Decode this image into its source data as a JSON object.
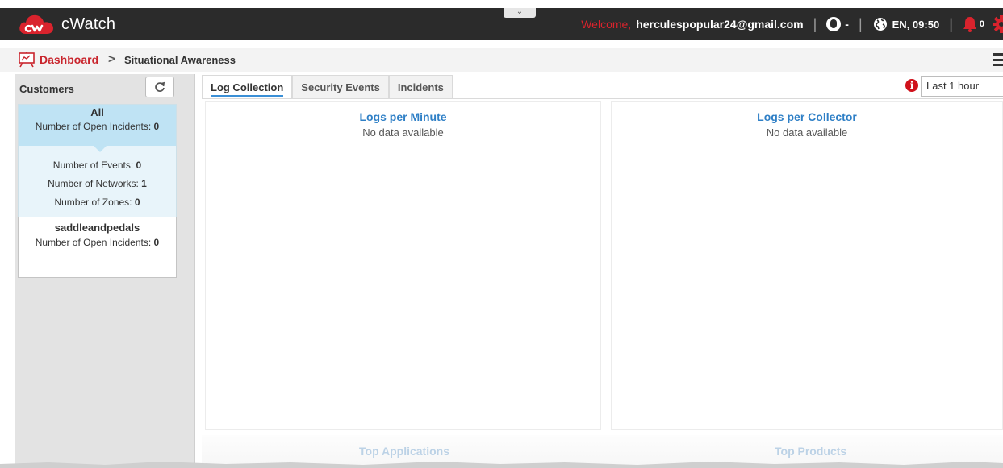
{
  "app": {
    "name": "cWatch",
    "collapse_glyph": "⌄"
  },
  "header": {
    "welcome": "Welcome,",
    "email": "herculespopular24@gmail.com",
    "user_caret": "-",
    "lang_time": "EN, 09:50",
    "notifications": "0",
    "separator": "|",
    "brand_color": "#d9232d"
  },
  "breadcrumb": {
    "root": "Dashboard",
    "chevron": ">",
    "current": "Situational Awareness"
  },
  "sidebar": {
    "title": "Customers",
    "all": {
      "name": "All",
      "open_incidents_label": "Number of Open Incidents:",
      "open_incidents": "0",
      "events_label": "Number of Events:",
      "events": "0",
      "networks_label": "Number of Networks:",
      "networks": "1",
      "zones_label": "Number of Zones:",
      "zones": "0"
    },
    "customers": [
      {
        "name": "saddleandpedals",
        "open_incidents_label": "Number of Open Incidents:",
        "open_incidents": "0"
      }
    ]
  },
  "tabs": [
    {
      "label": "Log Collection",
      "active": true
    },
    {
      "label": "Security Events",
      "active": false
    },
    {
      "label": "Incidents",
      "active": false
    }
  ],
  "time_range": {
    "info": "i",
    "selected": "Last 1 hour"
  },
  "panels": {
    "logs_per_minute": {
      "title": "Logs per Minute",
      "empty": "No data available"
    },
    "logs_per_collector": {
      "title": "Logs per Collector",
      "empty": "No data available"
    },
    "top_applications": {
      "title": "Top Applications"
    },
    "top_products": {
      "title": "Top Products"
    }
  }
}
